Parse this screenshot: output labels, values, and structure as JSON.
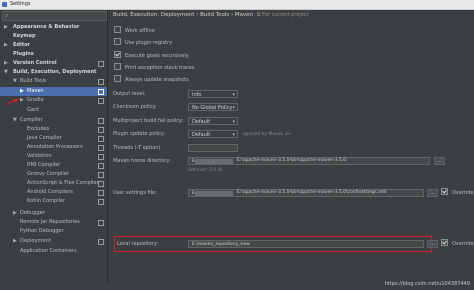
{
  "window": {
    "title": "Settings"
  },
  "sidebar": {
    "items": [
      {
        "label": "Appearance & Behavior",
        "arrow": "▶"
      },
      {
        "label": "Keymap"
      },
      {
        "label": "Editor",
        "arrow": "▶"
      },
      {
        "label": "Plugins"
      },
      {
        "label": "Version Control",
        "arrow": "▶"
      },
      {
        "label": "Build, Execution, Deployment",
        "arrow": "▼"
      },
      {
        "label": "Build Tools",
        "arrow": "▼"
      },
      {
        "label": "Maven",
        "arrow": "▶"
      },
      {
        "label": "Gradle",
        "arrow": "▶"
      },
      {
        "label": "Gant"
      },
      {
        "label": "Compiler",
        "arrow": "▼"
      },
      {
        "label": "Excludes"
      },
      {
        "label": "Java Compiler"
      },
      {
        "label": "Annotation Processors"
      },
      {
        "label": "Validation"
      },
      {
        "label": "RMI Compiler"
      },
      {
        "label": "Groovy Compiler"
      },
      {
        "label": "ActionScript & Flex Compiler"
      },
      {
        "label": "Android Compilers"
      },
      {
        "label": "Kotlin Compiler"
      },
      {
        "label": "Debugger",
        "arrow": "▶"
      },
      {
        "label": "Remote Jar Repositories"
      },
      {
        "label": "Python Debugger"
      },
      {
        "label": "Deployment",
        "arrow": "▶"
      },
      {
        "label": "Application Containers"
      }
    ]
  },
  "breadcrumb": {
    "path": "Build, Execution, Deployment › Build Tools › Maven",
    "project_note": "For current project"
  },
  "checkboxes": [
    {
      "label": "Work offline",
      "checked": false
    },
    {
      "label": "Use plugin registry",
      "checked": false
    },
    {
      "label": "Execute goals recursively",
      "checked": true
    },
    {
      "label": "Print exception stack traces",
      "checked": false
    },
    {
      "label": "Always update snapshots",
      "checked": false
    }
  ],
  "fields": {
    "output_level": {
      "label": "Output level:",
      "value": "Info"
    },
    "checksum_policy": {
      "label": "Checksum policy:",
      "value": "No Global Policy"
    },
    "multiproject": {
      "label": "Multiproject build fail policy:",
      "value": "Default"
    },
    "plugin_update": {
      "label": "Plugin update policy:",
      "value": "Default",
      "hint": "ignored by Maven 3+"
    },
    "threads": {
      "label": "Threads (-T option)",
      "value": ""
    },
    "maven_home": {
      "label": "Maven home directory:",
      "value": "E:\\apache-maven-3.5.0-bin\\apache-maven-3.5.0",
      "prefix": "E",
      "version": "(Version: 3.5.0)"
    },
    "user_settings": {
      "label": "User settings file:",
      "value": "E:\\apache-maven-3.5.0-bin\\apache-maven-3.5.0\\conf\\settings.xml",
      "prefix": "E"
    },
    "local_repo": {
      "label": "Local repository:",
      "value": "E:\\maven_repository_new"
    }
  },
  "buttons": {
    "browse": "..."
  },
  "override_label": "Override",
  "watermark": "https://blog.csdn.net/u104387449"
}
